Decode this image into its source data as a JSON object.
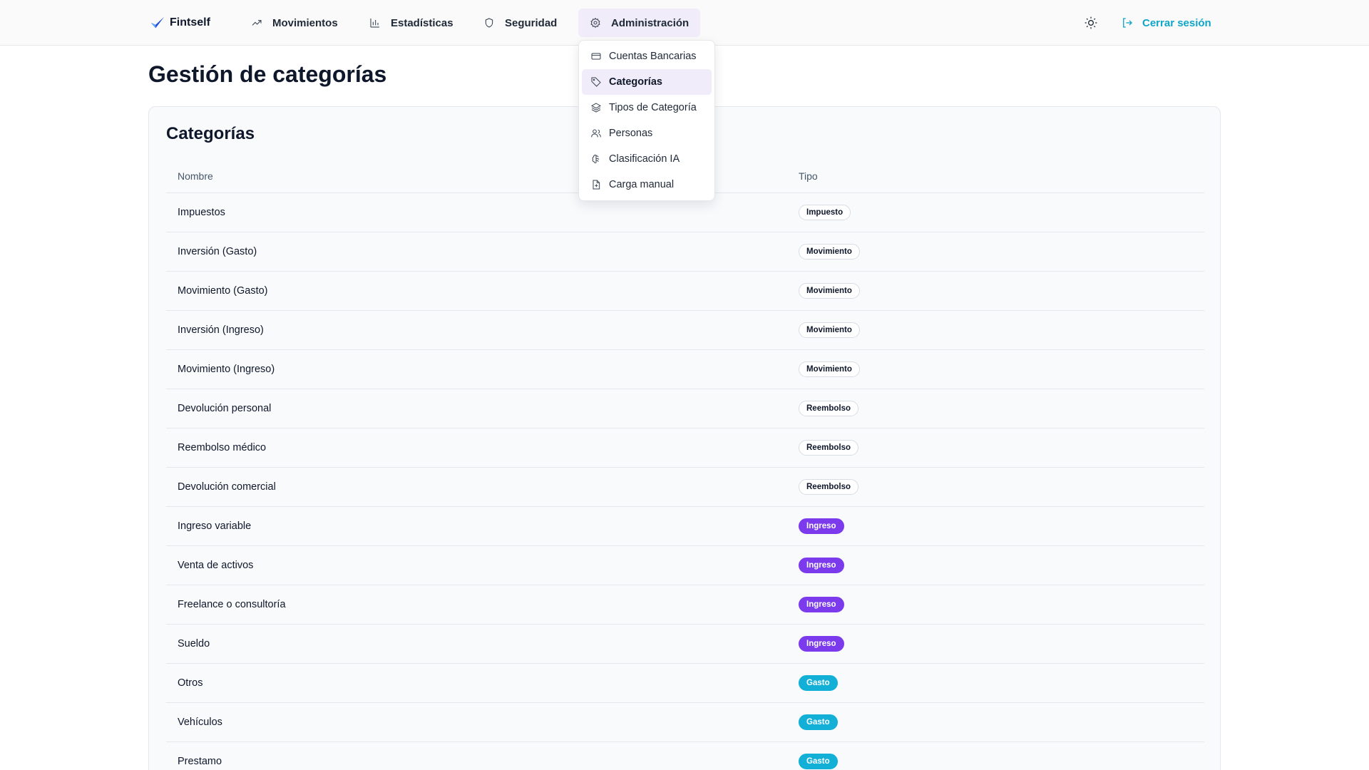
{
  "app": {
    "name": "Fintself"
  },
  "nav": {
    "items": [
      {
        "label": "Movimientos",
        "icon": "trending-up-icon"
      },
      {
        "label": "Estadísticas",
        "icon": "bar-chart-icon"
      },
      {
        "label": "Seguridad",
        "icon": "shield-icon"
      },
      {
        "label": "Administración",
        "icon": "gear-icon",
        "active": true
      }
    ],
    "theme_icon": "sun-icon",
    "logout_label": "Cerrar sesión"
  },
  "dropdown": {
    "items": [
      {
        "label": "Cuentas Bancarias",
        "icon": "credit-card-icon"
      },
      {
        "label": "Categorías",
        "icon": "tag-icon",
        "selected": true
      },
      {
        "label": "Tipos de Categoría",
        "icon": "layers-icon"
      },
      {
        "label": "Personas",
        "icon": "users-icon"
      },
      {
        "label": "Clasificación IA",
        "icon": "brain-icon"
      },
      {
        "label": "Carga manual",
        "icon": "file-plus-icon"
      }
    ]
  },
  "page": {
    "title": "Gestión de categorías"
  },
  "card": {
    "title": "Categorías"
  },
  "table": {
    "columns": [
      "Nombre",
      "Tipo"
    ],
    "rows": [
      {
        "name": "Impuestos",
        "type": "Impuesto"
      },
      {
        "name": "Inversión (Gasto)",
        "type": "Movimiento"
      },
      {
        "name": "Movimiento (Gasto)",
        "type": "Movimiento"
      },
      {
        "name": "Inversión (Ingreso)",
        "type": "Movimiento"
      },
      {
        "name": "Movimiento (Ingreso)",
        "type": "Movimiento"
      },
      {
        "name": "Devolución personal",
        "type": "Reembolso"
      },
      {
        "name": "Reembolso médico",
        "type": "Reembolso"
      },
      {
        "name": "Devolución comercial",
        "type": "Reembolso"
      },
      {
        "name": "Ingreso variable",
        "type": "Ingreso"
      },
      {
        "name": "Venta de activos",
        "type": "Ingreso"
      },
      {
        "name": "Freelance o consultoría",
        "type": "Ingreso"
      },
      {
        "name": "Sueldo",
        "type": "Ingreso"
      },
      {
        "name": "Otros",
        "type": "Gasto"
      },
      {
        "name": "Vehículos",
        "type": "Gasto"
      },
      {
        "name": "Prestamo",
        "type": "Gasto"
      }
    ]
  },
  "colors": {
    "accent_purple": "#7c3aed",
    "accent_cyan": "#12afd6",
    "active_bg": "#f1ecfa"
  }
}
